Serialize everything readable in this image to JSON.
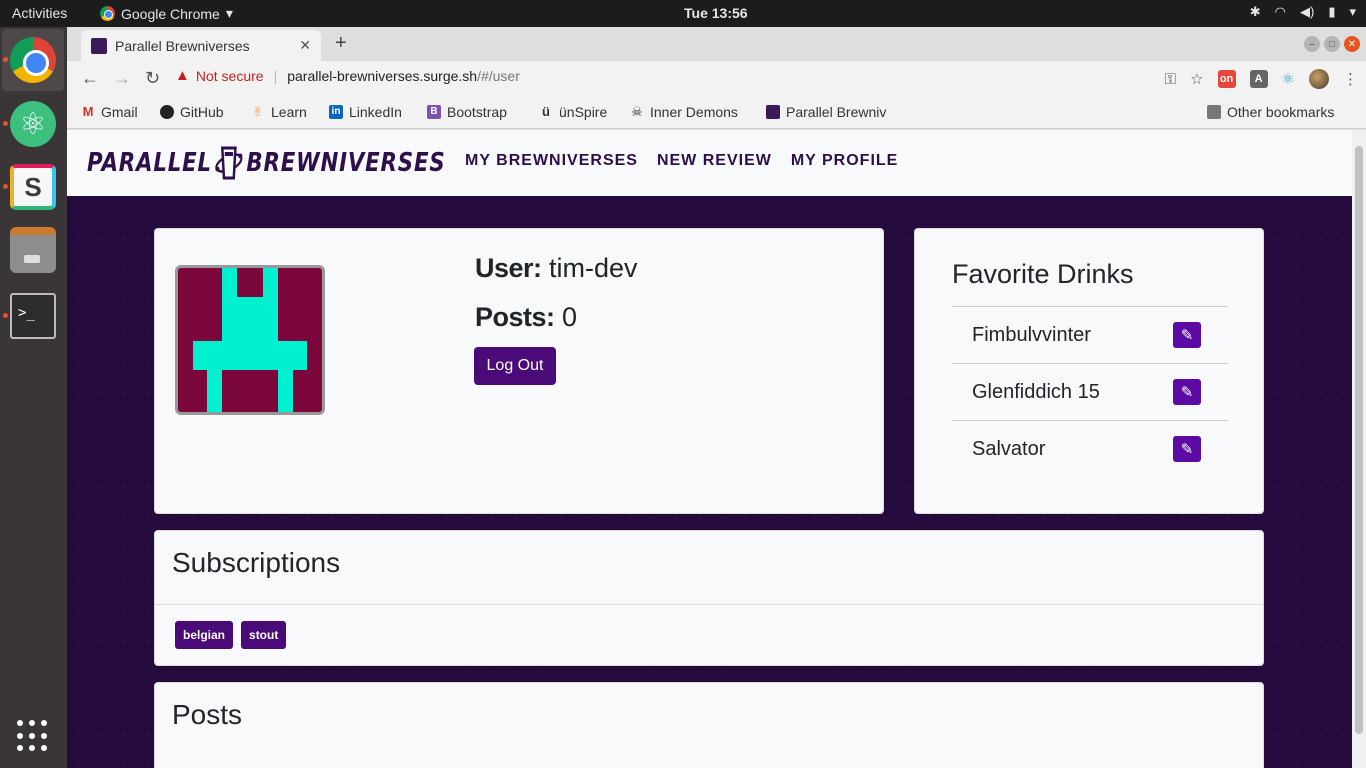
{
  "os": {
    "activities": "Activities",
    "app_name": "Google Chrome",
    "clock": "Tue 13:56"
  },
  "browser": {
    "tab_title": "Parallel Brewniverses",
    "not_secure": "Not secure",
    "url_host": "parallel-brewniverses.surge.sh",
    "url_path": "/#/user",
    "bookmarks": [
      "Gmail",
      "GitHub",
      "Learn",
      "LinkedIn",
      "Bootstrap",
      "ünSpire",
      "Inner Demons",
      "Parallel Brewniv"
    ],
    "other_bookmarks": "Other bookmarks"
  },
  "site": {
    "logo_left": "PARALLEL",
    "logo_right": "BREWNIVERSES",
    "nav": [
      "MY BREWNIVERSES",
      "NEW REVIEW",
      "MY PROFILE"
    ]
  },
  "profile": {
    "user_label": "User:",
    "username": "tim-dev",
    "posts_label": "Posts:",
    "posts_count": "0",
    "logout_label": "Log Out"
  },
  "favorites": {
    "title": "Favorite Drinks",
    "items": [
      "Fimbulvvinter",
      "Glenfiddich 15",
      "Salvator"
    ]
  },
  "subscriptions": {
    "title": "Subscriptions",
    "tags": [
      "belgian",
      "stout"
    ]
  },
  "posts": {
    "title": "Posts"
  },
  "colors": {
    "brand_purple": "#4a0a77",
    "page_bg": "#240a3d",
    "identicon_bg": "#7c073c",
    "identicon_fg": "#00f0d0"
  }
}
